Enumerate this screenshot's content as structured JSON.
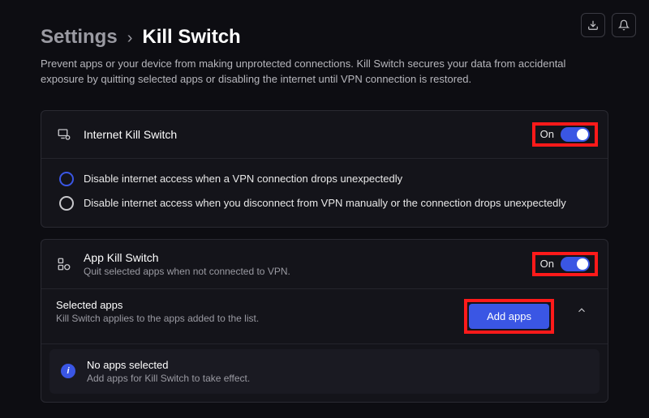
{
  "breadcrumb": {
    "parent": "Settings",
    "current": "Kill Switch"
  },
  "page_description": "Prevent apps or your device from making unprotected connections. Kill Switch secures your data from accidental exposure by quitting selected apps or disabling the internet until VPN connection is restored.",
  "internet_switch": {
    "title": "Internet Kill Switch",
    "state_label": "On",
    "options": [
      {
        "label": "Disable internet access when a VPN connection drops unexpectedly",
        "selected": true
      },
      {
        "label": "Disable internet access when you disconnect from VPN manually or the connection drops unexpectedly",
        "selected": false
      }
    ]
  },
  "app_switch": {
    "title": "App Kill Switch",
    "subtitle": "Quit selected apps when not connected to VPN.",
    "state_label": "On"
  },
  "selected_apps": {
    "title": "Selected apps",
    "subtitle": "Kill Switch applies to the apps added to the list.",
    "add_button": "Add apps",
    "empty_title": "No apps selected",
    "empty_sub": "Add apps for Kill Switch to take effect."
  }
}
